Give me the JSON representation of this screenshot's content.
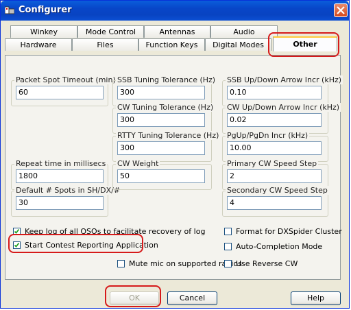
{
  "window": {
    "title": "Configurer"
  },
  "tabs_row1": [
    {
      "label": "Winkey"
    },
    {
      "label": "Mode Control"
    },
    {
      "label": "Antennas"
    },
    {
      "label": "Audio"
    }
  ],
  "tabs_row2": [
    {
      "label": "Hardware"
    },
    {
      "label": "Files"
    },
    {
      "label": "Function Keys"
    },
    {
      "label": "Digital Modes"
    },
    {
      "label": "Other"
    }
  ],
  "active_tab": "Other",
  "fields": {
    "packet_spot_timeout": {
      "label": "Packet Spot Timeout (min)",
      "value": "60"
    },
    "ssb_tuning_tolerance": {
      "label": "SSB Tuning Tolerance (Hz)",
      "value": "300"
    },
    "ssb_updown_incr": {
      "label": "SSB Up/Down Arrow Incr (kHz)",
      "value": "0.10"
    },
    "cw_tuning_tolerance": {
      "label": "CW Tuning Tolerance (Hz)",
      "value": "300"
    },
    "cw_updown_incr": {
      "label": "CW Up/Down Arrow Incr (kHz)",
      "value": "0.02"
    },
    "rtty_tuning_tolerance": {
      "label": "RTTY Tuning Tolerance (Hz)",
      "value": "300"
    },
    "pgup_pgdn_incr": {
      "label": "PgUp/PgDn Incr (kHz)",
      "value": "10.00"
    },
    "repeat_time": {
      "label": "Repeat time in millisecs",
      "value": "1800"
    },
    "cw_weight": {
      "label": "CW Weight",
      "value": "50"
    },
    "primary_cw_speed_step": {
      "label": "Primary CW Speed Step",
      "value": "2"
    },
    "default_spots": {
      "label": "Default # Spots in SH/DX/#",
      "value": "30"
    },
    "secondary_cw_speed_step": {
      "label": "Secondary CW Speed Step",
      "value": "4"
    }
  },
  "checkboxes": {
    "keep_log": {
      "label": "Keep log of all QSOs to facilitate recovery of log",
      "checked": true
    },
    "start_contest_reporting": {
      "label": "Start Contest Reporting Application",
      "checked": true
    },
    "mute_mic": {
      "label": "Mute mic on supported radios",
      "checked": false
    },
    "format_dxspider": {
      "label": "Format for DXSpider Cluster",
      "checked": false
    },
    "auto_completion": {
      "label": "Auto-Completion Mode",
      "checked": false
    },
    "use_reverse_cw": {
      "label": "Use Reverse CW",
      "checked": false
    }
  },
  "buttons": {
    "ok": "OK",
    "cancel": "Cancel",
    "help": "Help"
  },
  "colors": {
    "highlight": "#d61a1a",
    "titlebar": "#0846c8",
    "active_tab_accent": "#ffc83c"
  }
}
